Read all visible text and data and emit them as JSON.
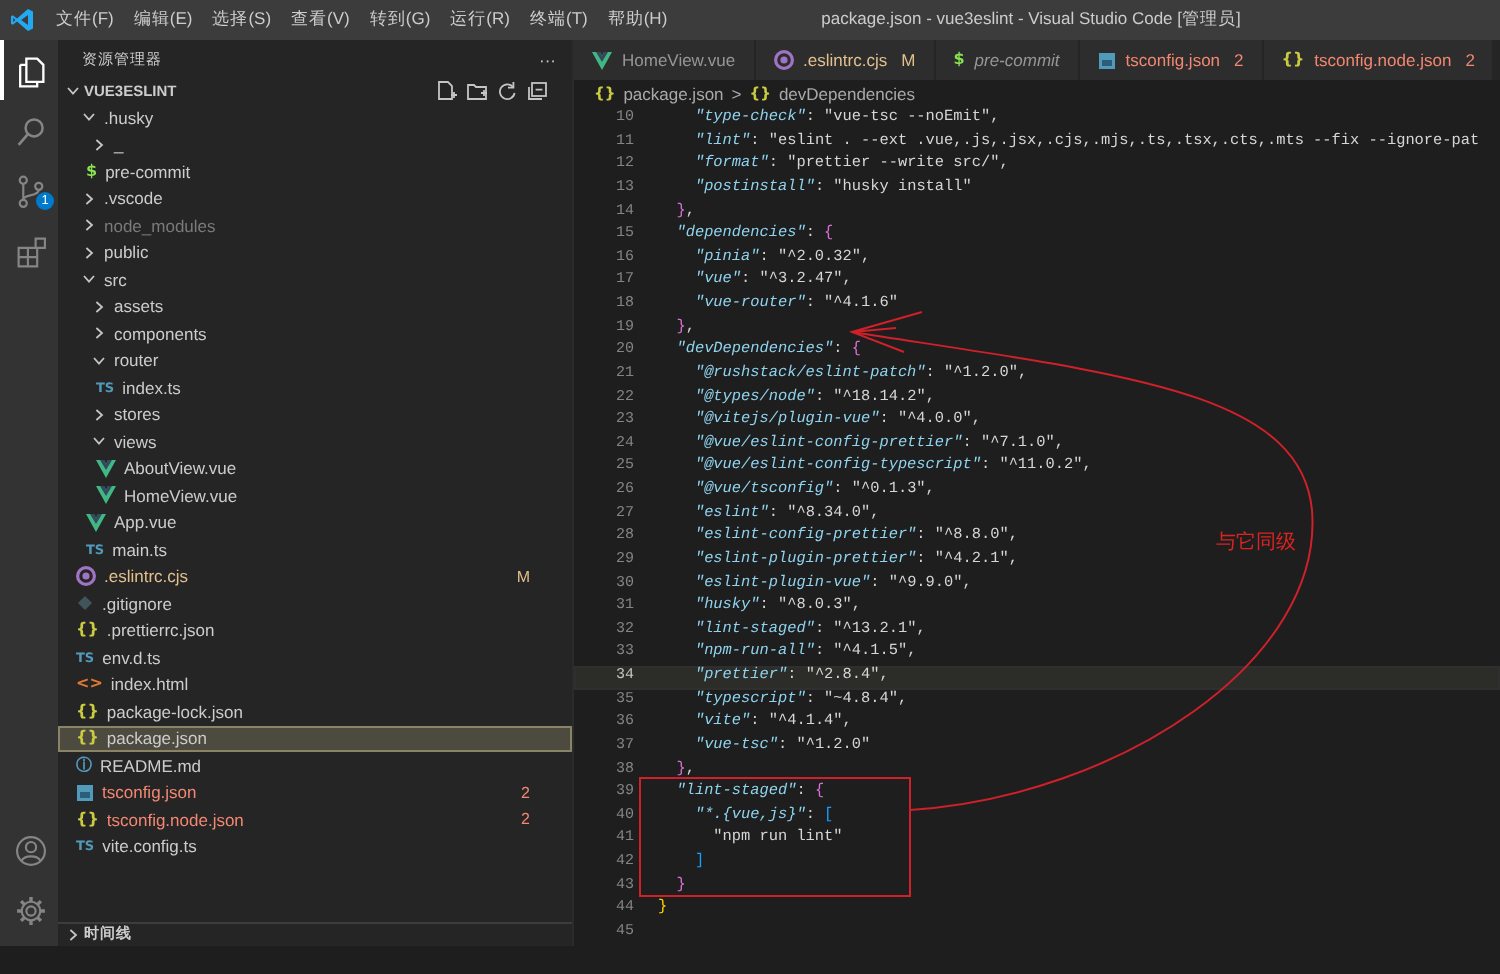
{
  "window": {
    "title": "package.json - vue3eslint - Visual Studio Code [管理员]"
  },
  "menu": [
    "文件(F)",
    "编辑(E)",
    "选择(S)",
    "查看(V)",
    "转到(G)",
    "运行(R)",
    "终端(T)",
    "帮助(H)"
  ],
  "activity_bar": [
    {
      "kind": "explorer",
      "selected": true
    },
    {
      "kind": "search",
      "selected": false
    },
    {
      "kind": "source-control",
      "selected": false,
      "badge": "1"
    },
    {
      "kind": "extensions",
      "selected": false
    }
  ],
  "activity_bar_bottom": [
    {
      "kind": "account"
    },
    {
      "kind": "settings"
    }
  ],
  "sidebar": {
    "title": "资源管理器",
    "more": "···",
    "section": "VUE3ESLINT",
    "section_expanded": true,
    "tree": [
      {
        "kind": "folder",
        "name": ".husky",
        "expanded": true,
        "selected": false,
        "children": [
          {
            "kind": "folder",
            "name": "_",
            "expanded": false,
            "selected": false
          },
          {
            "kind": "shell",
            "name": "pre-commit",
            "glyph": "$",
            "selected": false
          }
        ]
      },
      {
        "kind": "folder",
        "name": ".vscode",
        "expanded": false,
        "selected": false
      },
      {
        "kind": "folder",
        "name": "node_modules",
        "expanded": false,
        "selected": false,
        "dimmed": true
      },
      {
        "kind": "folder",
        "name": "public",
        "expanded": false,
        "selected": false
      },
      {
        "kind": "folder",
        "name": "src",
        "expanded": true,
        "selected": false,
        "children": [
          {
            "kind": "folder",
            "name": "assets",
            "expanded": false,
            "selected": false
          },
          {
            "kind": "folder",
            "name": "components",
            "expanded": false,
            "selected": false
          },
          {
            "kind": "folder",
            "name": "router",
            "expanded": true,
            "selected": false,
            "children": [
              {
                "kind": "ts",
                "name": "index.ts",
                "glyph": "TS",
                "selected": false
              }
            ]
          },
          {
            "kind": "folder",
            "name": "stores",
            "expanded": false,
            "selected": false
          },
          {
            "kind": "folder",
            "name": "views",
            "expanded": true,
            "selected": false,
            "children": [
              {
                "kind": "vue",
                "name": "AboutView.vue",
                "selected": false
              },
              {
                "kind": "vue",
                "name": "HomeView.vue",
                "selected": false
              }
            ]
          },
          {
            "kind": "vue",
            "name": "App.vue",
            "selected": false
          },
          {
            "kind": "ts",
            "name": "main.ts",
            "glyph": "TS",
            "selected": false
          }
        ]
      },
      {
        "kind": "eslint",
        "name": ".eslintrc.cjs",
        "selected": false,
        "modified": true,
        "badge": "M"
      },
      {
        "kind": "git",
        "name": ".gitignore",
        "selected": false
      },
      {
        "kind": "json",
        "name": ".prettierrc.json",
        "glyph": "{}",
        "selected": false
      },
      {
        "kind": "ts",
        "name": "env.d.ts",
        "glyph": "TS",
        "selected": false
      },
      {
        "kind": "html",
        "name": "index.html",
        "glyph": "<>",
        "selected": false
      },
      {
        "kind": "json",
        "name": "package-lock.json",
        "glyph": "{}",
        "selected": false
      },
      {
        "kind": "json",
        "name": "package.json",
        "glyph": "{}",
        "selected": true
      },
      {
        "kind": "info",
        "name": "README.md",
        "glyph": "ⓘ",
        "selected": false
      },
      {
        "kind": "tsconfig",
        "name": "tsconfig.json",
        "selected": false,
        "has_errors": true,
        "badge": "2"
      },
      {
        "kind": "json",
        "name": "tsconfig.node.json",
        "glyph": "{}",
        "selected": false,
        "has_errors": true,
        "badge": "2"
      },
      {
        "kind": "ts",
        "name": "vite.config.ts",
        "glyph": "TS",
        "selected": false
      }
    ],
    "timeline": {
      "label": "时间线",
      "expanded": false
    }
  },
  "tabs": [
    {
      "label": "HomeView.vue",
      "kind": "vue",
      "selected": false
    },
    {
      "label": ".eslintrc.cjs",
      "kind": "eslint",
      "selected": false,
      "modified": true,
      "badge": "M"
    },
    {
      "label": "pre-commit",
      "kind": "shell",
      "glyph": "$",
      "selected": false,
      "preview": true
    },
    {
      "label": "tsconfig.json",
      "kind": "tsconfig",
      "selected": false,
      "has_errors": true,
      "badge": "2"
    },
    {
      "label": "tsconfig.node.json",
      "kind": "json",
      "glyph": "{}",
      "selected": false,
      "has_errors": true,
      "badge": "2"
    }
  ],
  "breadcrumb": {
    "separator": ">",
    "items": [
      {
        "glyph": "{}",
        "label": "package.json"
      },
      {
        "glyph": "{}",
        "label": "devDependencies"
      }
    ]
  },
  "code": [
    {
      "n": "10",
      "current": false,
      "tokens": [
        {
          "kind": "key",
          "text": "    \"type-check\""
        },
        {
          "kind": "punct",
          "text": ": "
        },
        {
          "kind": "string",
          "text": "\"vue-tsc --noEmit\""
        },
        {
          "kind": "punct",
          "text": ","
        }
      ]
    },
    {
      "n": "11",
      "current": false,
      "tokens": [
        {
          "kind": "key",
          "text": "    \"lint\""
        },
        {
          "kind": "punct",
          "text": ": "
        },
        {
          "kind": "string",
          "text": "\"eslint . --ext .vue,.js,.jsx,.cjs,.mjs,.ts,.tsx,.cts,.mts --fix --ignore-pat"
        }
      ]
    },
    {
      "n": "12",
      "current": false,
      "tokens": [
        {
          "kind": "key",
          "text": "    \"format\""
        },
        {
          "kind": "punct",
          "text": ": "
        },
        {
          "kind": "string",
          "text": "\"prettier --write src/\""
        },
        {
          "kind": "punct",
          "text": ","
        }
      ]
    },
    {
      "n": "13",
      "current": false,
      "tokens": [
        {
          "kind": "key",
          "text": "    \"postinstall\""
        },
        {
          "kind": "punct",
          "text": ": "
        },
        {
          "kind": "string",
          "text": "\"husky install\""
        }
      ]
    },
    {
      "n": "14",
      "current": false,
      "tokens": [
        {
          "kind": "bracket2",
          "text": "  }"
        },
        {
          "kind": "punct",
          "text": ","
        }
      ]
    },
    {
      "n": "15",
      "current": false,
      "tokens": [
        {
          "kind": "key",
          "text": "  \"dependencies\""
        },
        {
          "kind": "punct",
          "text": ": "
        },
        {
          "kind": "bracket2",
          "text": "{"
        }
      ]
    },
    {
      "n": "16",
      "current": false,
      "tokens": [
        {
          "kind": "key",
          "text": "    \"pinia\""
        },
        {
          "kind": "punct",
          "text": ": "
        },
        {
          "kind": "string",
          "text": "\"^2.0.32\""
        },
        {
          "kind": "punct",
          "text": ","
        }
      ]
    },
    {
      "n": "17",
      "current": false,
      "tokens": [
        {
          "kind": "key",
          "text": "    \"vue\""
        },
        {
          "kind": "punct",
          "text": ": "
        },
        {
          "kind": "string",
          "text": "\"^3.2.47\""
        },
        {
          "kind": "punct",
          "text": ","
        }
      ]
    },
    {
      "n": "18",
      "current": false,
      "tokens": [
        {
          "kind": "key",
          "text": "    \"vue-router\""
        },
        {
          "kind": "punct",
          "text": ": "
        },
        {
          "kind": "string",
          "text": "\"^4.1.6\""
        }
      ]
    },
    {
      "n": "19",
      "current": false,
      "tokens": [
        {
          "kind": "bracket2",
          "text": "  }"
        },
        {
          "kind": "punct",
          "text": ","
        }
      ]
    },
    {
      "n": "20",
      "current": false,
      "tokens": [
        {
          "kind": "key",
          "text": "  \"devDependencies\""
        },
        {
          "kind": "punct",
          "text": ": "
        },
        {
          "kind": "bracket2",
          "text": "{"
        }
      ]
    },
    {
      "n": "21",
      "current": false,
      "tokens": [
        {
          "kind": "key",
          "text": "    \"@rushstack/eslint-patch\""
        },
        {
          "kind": "punct",
          "text": ": "
        },
        {
          "kind": "string",
          "text": "\"^1.2.0\""
        },
        {
          "kind": "punct",
          "text": ","
        }
      ]
    },
    {
      "n": "22",
      "current": false,
      "tokens": [
        {
          "kind": "key",
          "text": "    \"@types/node\""
        },
        {
          "kind": "punct",
          "text": ": "
        },
        {
          "kind": "string",
          "text": "\"^18.14.2\""
        },
        {
          "kind": "punct",
          "text": ","
        }
      ]
    },
    {
      "n": "23",
      "current": false,
      "tokens": [
        {
          "kind": "key",
          "text": "    \"@vitejs/plugin-vue\""
        },
        {
          "kind": "punct",
          "text": ": "
        },
        {
          "kind": "string",
          "text": "\"^4.0.0\""
        },
        {
          "kind": "punct",
          "text": ","
        }
      ]
    },
    {
      "n": "24",
      "current": false,
      "tokens": [
        {
          "kind": "key",
          "text": "    \"@vue/eslint-config-prettier\""
        },
        {
          "kind": "punct",
          "text": ": "
        },
        {
          "kind": "string",
          "text": "\"^7.1.0\""
        },
        {
          "kind": "punct",
          "text": ","
        }
      ]
    },
    {
      "n": "25",
      "current": false,
      "tokens": [
        {
          "kind": "key",
          "text": "    \"@vue/eslint-config-typescript\""
        },
        {
          "kind": "punct",
          "text": ": "
        },
        {
          "kind": "string",
          "text": "\"^11.0.2\""
        },
        {
          "kind": "punct",
          "text": ","
        }
      ]
    },
    {
      "n": "26",
      "current": false,
      "tokens": [
        {
          "kind": "key",
          "text": "    \"@vue/tsconfig\""
        },
        {
          "kind": "punct",
          "text": ": "
        },
        {
          "kind": "string",
          "text": "\"^0.1.3\""
        },
        {
          "kind": "punct",
          "text": ","
        }
      ]
    },
    {
      "n": "27",
      "current": false,
      "tokens": [
        {
          "kind": "key",
          "text": "    \"eslint\""
        },
        {
          "kind": "punct",
          "text": ": "
        },
        {
          "kind": "string",
          "text": "\"^8.34.0\""
        },
        {
          "kind": "punct",
          "text": ","
        }
      ]
    },
    {
      "n": "28",
      "current": false,
      "tokens": [
        {
          "kind": "key",
          "text": "    \"eslint-config-prettier\""
        },
        {
          "kind": "punct",
          "text": ": "
        },
        {
          "kind": "string",
          "text": "\"^8.8.0\""
        },
        {
          "kind": "punct",
          "text": ","
        }
      ]
    },
    {
      "n": "29",
      "current": false,
      "tokens": [
        {
          "kind": "key",
          "text": "    \"eslint-plugin-prettier\""
        },
        {
          "kind": "punct",
          "text": ": "
        },
        {
          "kind": "string",
          "text": "\"^4.2.1\""
        },
        {
          "kind": "punct",
          "text": ","
        }
      ]
    },
    {
      "n": "30",
      "current": false,
      "tokens": [
        {
          "kind": "key",
          "text": "    \"eslint-plugin-vue\""
        },
        {
          "kind": "punct",
          "text": ": "
        },
        {
          "kind": "string",
          "text": "\"^9.9.0\""
        },
        {
          "kind": "punct",
          "text": ","
        }
      ]
    },
    {
      "n": "31",
      "current": false,
      "tokens": [
        {
          "kind": "key",
          "text": "    \"husky\""
        },
        {
          "kind": "punct",
          "text": ": "
        },
        {
          "kind": "string",
          "text": "\"^8.0.3\""
        },
        {
          "kind": "punct",
          "text": ","
        }
      ]
    },
    {
      "n": "32",
      "current": false,
      "tokens": [
        {
          "kind": "key",
          "text": "    \"lint-staged\""
        },
        {
          "kind": "punct",
          "text": ": "
        },
        {
          "kind": "string",
          "text": "\"^13.2.1\""
        },
        {
          "kind": "punct",
          "text": ","
        }
      ]
    },
    {
      "n": "33",
      "current": false,
      "tokens": [
        {
          "kind": "key",
          "text": "    \"npm-run-all\""
        },
        {
          "kind": "punct",
          "text": ": "
        },
        {
          "kind": "string",
          "text": "\"^4.1.5\""
        },
        {
          "kind": "punct",
          "text": ","
        }
      ]
    },
    {
      "n": "34",
      "current": true,
      "tokens": [
        {
          "kind": "key",
          "text": "    \"prettier\""
        },
        {
          "kind": "punct",
          "text": ": "
        },
        {
          "kind": "string",
          "text": "\"^2.8.4\""
        },
        {
          "kind": "punct",
          "text": ","
        }
      ]
    },
    {
      "n": "35",
      "current": false,
      "tokens": [
        {
          "kind": "key",
          "text": "    \"typescript\""
        },
        {
          "kind": "punct",
          "text": ": "
        },
        {
          "kind": "string",
          "text": "\"~4.8.4\""
        },
        {
          "kind": "punct",
          "text": ","
        }
      ]
    },
    {
      "n": "36",
      "current": false,
      "tokens": [
        {
          "kind": "key",
          "text": "    \"vite\""
        },
        {
          "kind": "punct",
          "text": ": "
        },
        {
          "kind": "string",
          "text": "\"^4.1.4\""
        },
        {
          "kind": "punct",
          "text": ","
        }
      ]
    },
    {
      "n": "37",
      "current": false,
      "tokens": [
        {
          "kind": "key",
          "text": "    \"vue-tsc\""
        },
        {
          "kind": "punct",
          "text": ": "
        },
        {
          "kind": "string",
          "text": "\"^1.2.0\""
        }
      ]
    },
    {
      "n": "38",
      "current": false,
      "tokens": [
        {
          "kind": "bracket2",
          "text": "  }"
        },
        {
          "kind": "punct",
          "text": ","
        }
      ]
    },
    {
      "n": "39",
      "current": false,
      "tokens": [
        {
          "kind": "key",
          "text": "  \"lint-staged\""
        },
        {
          "kind": "punct",
          "text": ": "
        },
        {
          "kind": "bracket2",
          "text": "{"
        }
      ]
    },
    {
      "n": "40",
      "current": false,
      "tokens": [
        {
          "kind": "key",
          "text": "    \"*.{vue,js}\""
        },
        {
          "kind": "punct",
          "text": ": "
        },
        {
          "kind": "bracket3",
          "text": "["
        }
      ]
    },
    {
      "n": "41",
      "current": false,
      "tokens": [
        {
          "kind": "string",
          "text": "      \"npm run lint\""
        }
      ]
    },
    {
      "n": "42",
      "current": false,
      "tokens": [
        {
          "kind": "bracket3",
          "text": "    ]"
        }
      ]
    },
    {
      "n": "43",
      "current": false,
      "tokens": [
        {
          "kind": "bracket2",
          "text": "  }"
        }
      ]
    },
    {
      "n": "44",
      "current": false,
      "tokens": [
        {
          "kind": "bracket1",
          "text": "}"
        }
      ]
    },
    {
      "n": "45",
      "current": false
    }
  ],
  "annotations": [
    {
      "kind": "box"
    },
    {
      "kind": "arrow"
    },
    {
      "kind": "note",
      "text": "与它同级"
    }
  ]
}
